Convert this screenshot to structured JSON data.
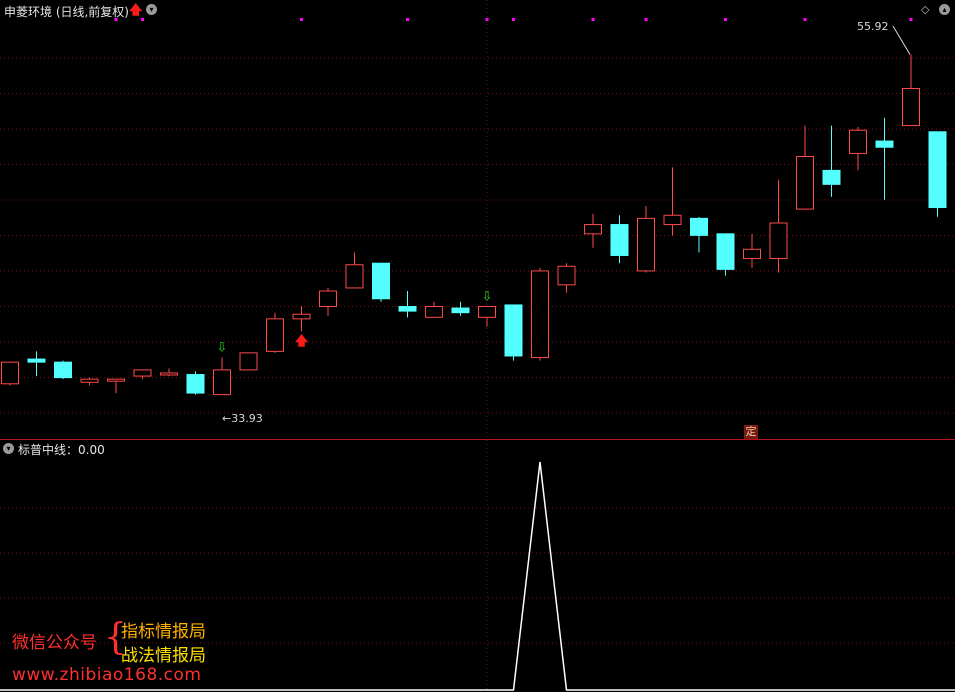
{
  "main_panel": {
    "title": "申菱环境 (日线,前复权)",
    "high_label": "55.92",
    "low_label": "33.93",
    "ding_badge": "定"
  },
  "sub_panel": {
    "title": "标普中线：0.00"
  },
  "watermark": {
    "wechat": "微信公众号",
    "brace": "{",
    "line1": "指标情报局",
    "line2": "战法情报局",
    "url": "www.zhibiao168.com"
  },
  "colors": {
    "up_candle": "#ff4a4a",
    "down_candle": "#54ffff",
    "grid": "#7a0a0a",
    "magenta_dot": "#ff00ff",
    "line": "#ffffff"
  },
  "chart_data": {
    "type": "candlestick",
    "price_range": [
      32.0,
      58.0
    ],
    "candles": [
      {
        "o": 34.6,
        "h": 36.0,
        "l": 34.5,
        "c": 36.0
      },
      {
        "o": 36.2,
        "h": 36.7,
        "l": 35.1,
        "c": 36.0
      },
      {
        "o": 36.0,
        "h": 36.1,
        "l": 34.9,
        "c": 35.0
      },
      {
        "o": 34.7,
        "h": 35.0,
        "l": 34.5,
        "c": 34.9
      },
      {
        "o": 34.9,
        "h": 34.9,
        "l": 34.0,
        "c": 34.9
      },
      {
        "o": 35.1,
        "h": 35.5,
        "l": 34.9,
        "c": 35.5
      },
      {
        "o": 35.3,
        "h": 35.6,
        "l": 35.1,
        "c": 35.3
      },
      {
        "o": 35.2,
        "h": 35.4,
        "l": 33.9,
        "c": 34.0
      },
      {
        "o": 33.9,
        "h": 36.3,
        "l": 33.9,
        "c": 35.5
      },
      {
        "o": 35.5,
        "h": 36.6,
        "l": 35.5,
        "c": 36.6
      },
      {
        "o": 36.7,
        "h": 39.2,
        "l": 36.6,
        "c": 38.8
      },
      {
        "o": 38.8,
        "h": 39.6,
        "l": 38.0,
        "c": 39.1
      },
      {
        "o": 39.6,
        "h": 40.8,
        "l": 39.0,
        "c": 40.6
      },
      {
        "o": 40.8,
        "h": 43.1,
        "l": 40.8,
        "c": 42.3
      },
      {
        "o": 42.4,
        "h": 42.4,
        "l": 39.9,
        "c": 40.1
      },
      {
        "o": 39.6,
        "h": 40.6,
        "l": 38.9,
        "c": 39.3
      },
      {
        "o": 38.9,
        "h": 39.9,
        "l": 38.9,
        "c": 39.6
      },
      {
        "o": 39.5,
        "h": 39.9,
        "l": 39.0,
        "c": 39.2
      },
      {
        "o": 38.9,
        "h": 39.6,
        "l": 38.3,
        "c": 39.6
      },
      {
        "o": 39.7,
        "h": 39.7,
        "l": 36.1,
        "c": 36.4
      },
      {
        "o": 36.3,
        "h": 42.1,
        "l": 36.1,
        "c": 41.9
      },
      {
        "o": 41.0,
        "h": 42.4,
        "l": 40.5,
        "c": 42.2
      },
      {
        "o": 44.3,
        "h": 45.6,
        "l": 43.4,
        "c": 44.9
      },
      {
        "o": 44.9,
        "h": 45.5,
        "l": 42.4,
        "c": 42.9
      },
      {
        "o": 41.9,
        "h": 46.1,
        "l": 41.8,
        "c": 45.3
      },
      {
        "o": 44.9,
        "h": 48.6,
        "l": 44.2,
        "c": 45.5
      },
      {
        "o": 45.3,
        "h": 45.4,
        "l": 43.1,
        "c": 44.2
      },
      {
        "o": 44.3,
        "h": 44.3,
        "l": 41.6,
        "c": 42.0
      },
      {
        "o": 42.7,
        "h": 44.3,
        "l": 42.1,
        "c": 43.3
      },
      {
        "o": 42.7,
        "h": 47.8,
        "l": 41.8,
        "c": 45.0
      },
      {
        "o": 45.9,
        "h": 51.3,
        "l": 45.9,
        "c": 49.3
      },
      {
        "o": 48.4,
        "h": 51.3,
        "l": 46.7,
        "c": 47.5
      },
      {
        "o": 49.5,
        "h": 51.2,
        "l": 48.4,
        "c": 51.0
      },
      {
        "o": 50.3,
        "h": 51.8,
        "l": 46.5,
        "c": 49.9
      },
      {
        "o": 51.3,
        "h": 55.9,
        "l": 51.3,
        "c": 53.7
      },
      {
        "o": 50.9,
        "h": 50.9,
        "l": 45.4,
        "c": 46.0
      }
    ],
    "markers": {
      "green_down_arrows": [
        8,
        18
      ],
      "red_up_arrows": [
        11
      ],
      "ding_badge_index": 28
    },
    "magenta_dots": [
      4,
      5,
      11,
      15,
      18,
      19,
      22,
      24,
      27,
      30,
      34
    ],
    "indicator": {
      "name": "标普中线",
      "value": 0.0,
      "values": [
        0,
        0,
        0,
        0,
        0,
        0,
        0,
        0,
        0,
        0,
        0,
        0,
        0,
        0,
        0,
        0,
        0,
        0,
        0,
        0,
        1,
        0,
        0,
        0,
        0,
        0,
        0,
        0,
        0,
        0,
        0,
        0,
        0,
        0,
        0,
        0
      ]
    }
  }
}
